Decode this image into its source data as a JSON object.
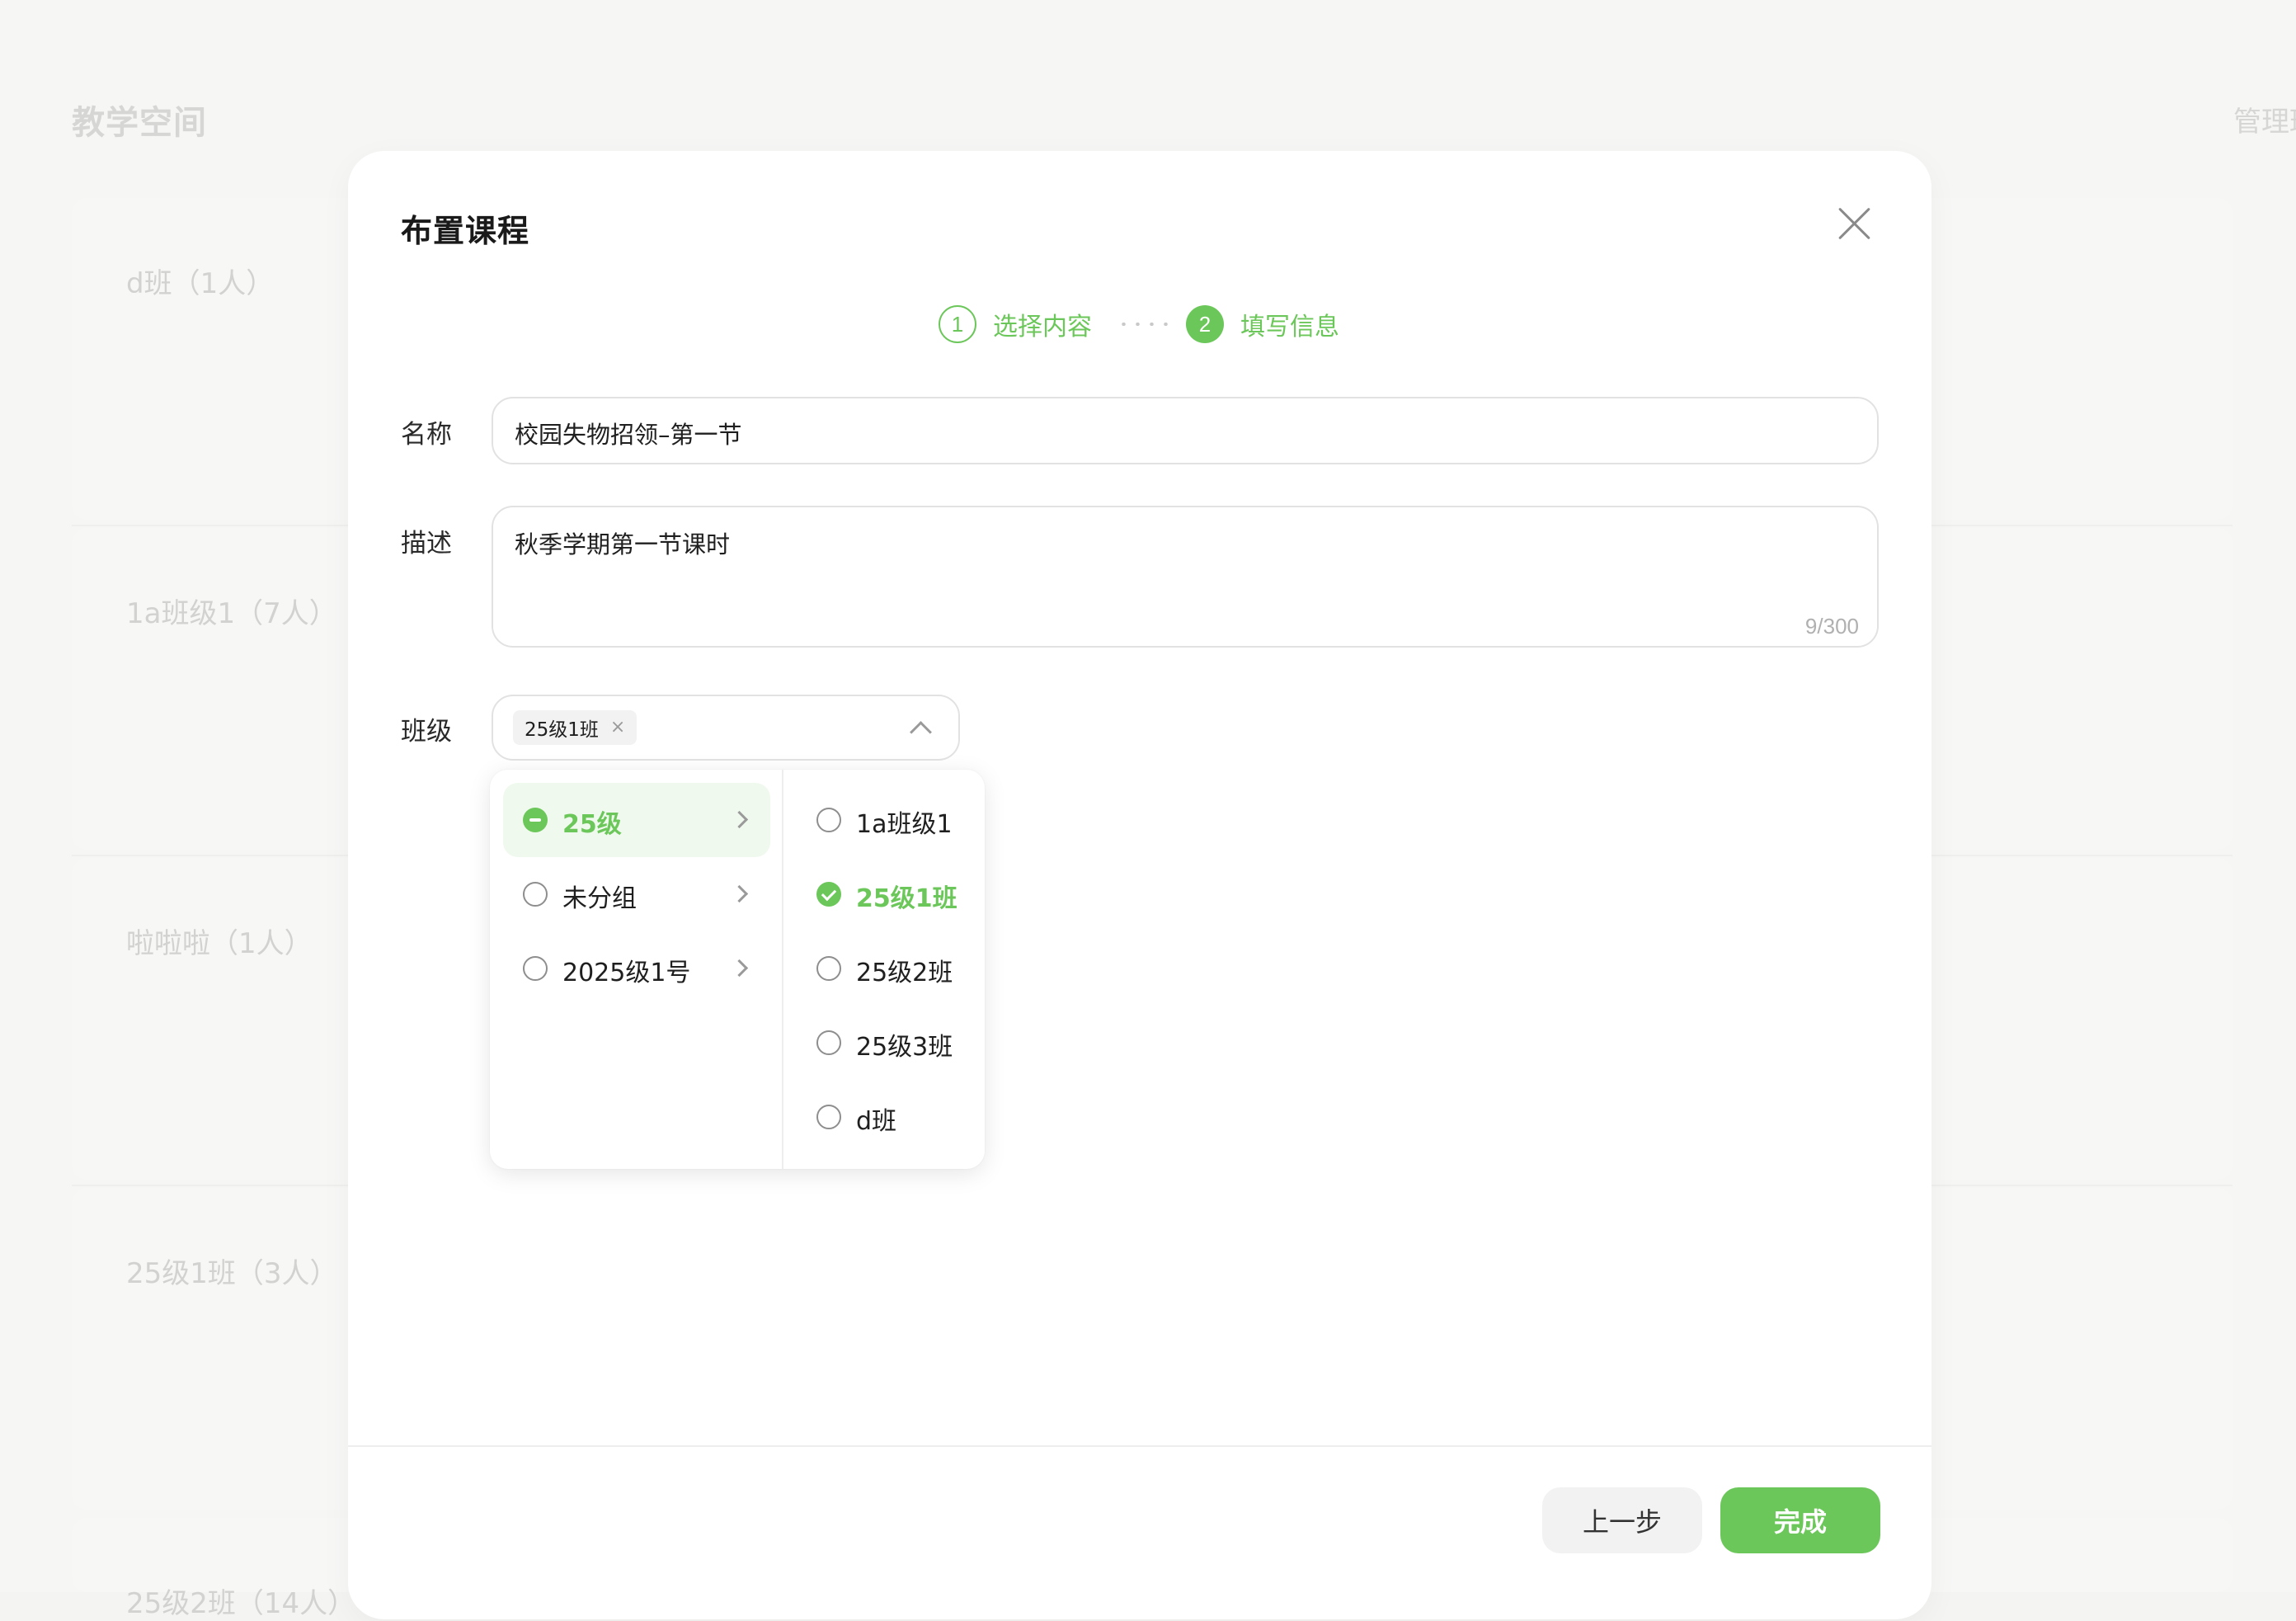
{
  "background": {
    "title": "教学空间",
    "manage_link": "管理班",
    "groups": [
      {
        "label": "d班（1人）"
      },
      {
        "label": "1a班级1（7人）"
      },
      {
        "label": "啦啦啦（1人）"
      },
      {
        "label": "25级1班（3人）"
      },
      {
        "label": "25级2班（14人）"
      }
    ]
  },
  "modal": {
    "title": "布置课程",
    "steps": [
      {
        "number": "1",
        "label": "选择内容",
        "state": "done"
      },
      {
        "number": "2",
        "label": "填写信息",
        "state": "active"
      }
    ],
    "form": {
      "name_label": "名称",
      "name_value": "校园失物招领–第一节",
      "desc_label": "描述",
      "desc_value": "秋季学期第一节课时",
      "desc_counter": "9/300",
      "class_label": "班级",
      "selected_tags": [
        {
          "label": "25级1班",
          "remove_icon": "×"
        }
      ]
    },
    "cascader": {
      "parents": [
        {
          "label": "25级",
          "state": "partial"
        },
        {
          "label": "未分组",
          "state": "unchecked"
        },
        {
          "label": "2025级1号",
          "state": "unchecked"
        }
      ],
      "children": [
        {
          "label": "1a班级1",
          "state": "unchecked"
        },
        {
          "label": "25级1班",
          "state": "checked"
        },
        {
          "label": "25级2班",
          "state": "unchecked"
        },
        {
          "label": "25级3班",
          "state": "unchecked"
        },
        {
          "label": "d班",
          "state": "unchecked"
        }
      ]
    },
    "footer": {
      "prev_label": "上一步",
      "finish_label": "完成"
    }
  },
  "colors": {
    "accent": "#6cc75a",
    "accent_light": "#f0f9ee",
    "border": "#e2e2e2",
    "muted_text": "#b0b0b0"
  }
}
